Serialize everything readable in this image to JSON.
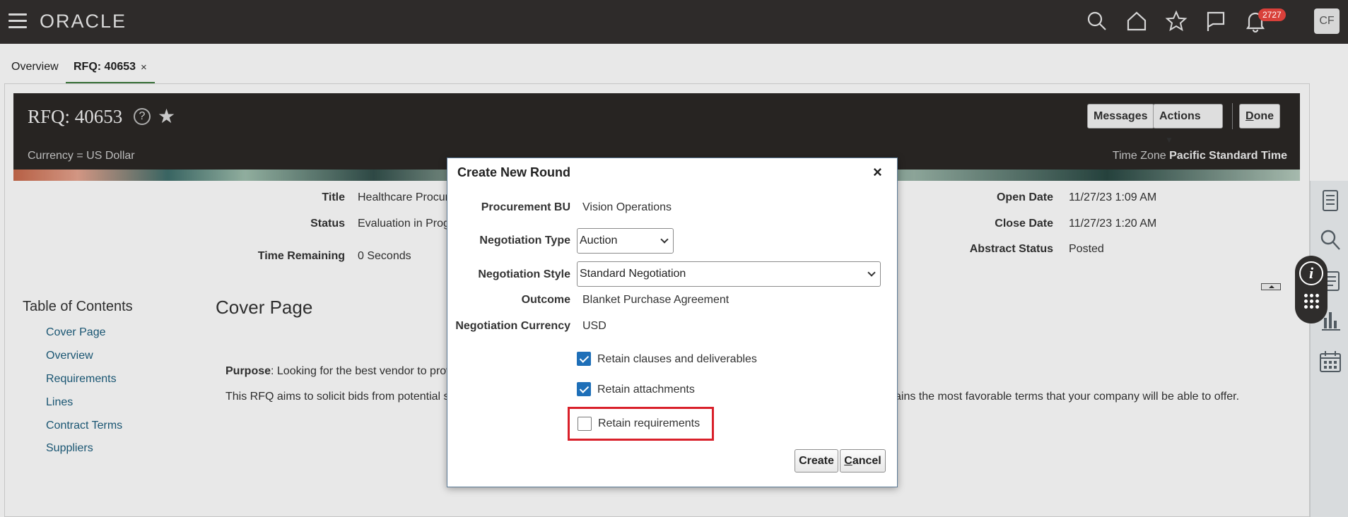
{
  "app": {
    "logo": "ORACLE",
    "notifications_count": "2727",
    "user_initials": "CF"
  },
  "tabs": [
    {
      "label": "Overview"
    },
    {
      "label": "RFQ: 40653",
      "close": "×"
    }
  ],
  "header": {
    "title": "RFQ: 40653",
    "currency": "Currency = US Dollar",
    "timezone_label": "Time Zone",
    "timezone_value": "Pacific Standard Time",
    "buttons": {
      "messages": "Messages",
      "actions": "Actions",
      "done_d": "D",
      "done_rest": "one"
    }
  },
  "fields": {
    "title_label": "Title",
    "title_value": "Healthcare Procur",
    "status_label": "Status",
    "status_value": "Evaluation in Prog",
    "time_remaining_label": "Time Remaining",
    "time_remaining_value": "0 Seconds",
    "open_date_label": "Open Date",
    "open_date_value": "11/27/23 1:09 AM",
    "close_date_label": "Close Date",
    "close_date_value": "11/27/23 1:20 AM",
    "abstract_status_label": "Abstract Status",
    "abstract_status_value": "Posted"
  },
  "toc": {
    "title": "Table of Contents",
    "items": [
      "Cover Page",
      "Overview",
      "Requirements",
      "Lines",
      "Contract Terms",
      "Suppliers"
    ]
  },
  "cover": {
    "title": "Cover Page",
    "purpose_label": "Purpose",
    "purpose_text": ": Looking for the best vendor to prov",
    "body_left": "This RFQ aims to solicit bids from potential su",
    "body_right": "ains the most favorable terms that your company will be able to offer."
  },
  "dialog": {
    "title": "Create New Round",
    "close": "×",
    "procurement_bu_label": "Procurement BU",
    "procurement_bu_value": "Vision Operations",
    "negotiation_type_label": "Negotiation Type",
    "negotiation_type_value": "Auction",
    "negotiation_style_label": "Negotiation Style",
    "negotiation_style_value": "Standard Negotiation",
    "outcome_label": "Outcome",
    "outcome_value": "Blanket Purchase Agreement",
    "currency_label": "Negotiation Currency",
    "currency_value": "USD",
    "retain_clauses_label": "Retain clauses and deliverables",
    "retain_attachments_label": "Retain attachments",
    "retain_requirements_label": "Retain requirements",
    "create_label": "Create",
    "cancel_c": "C",
    "cancel_rest": "ancel"
  }
}
